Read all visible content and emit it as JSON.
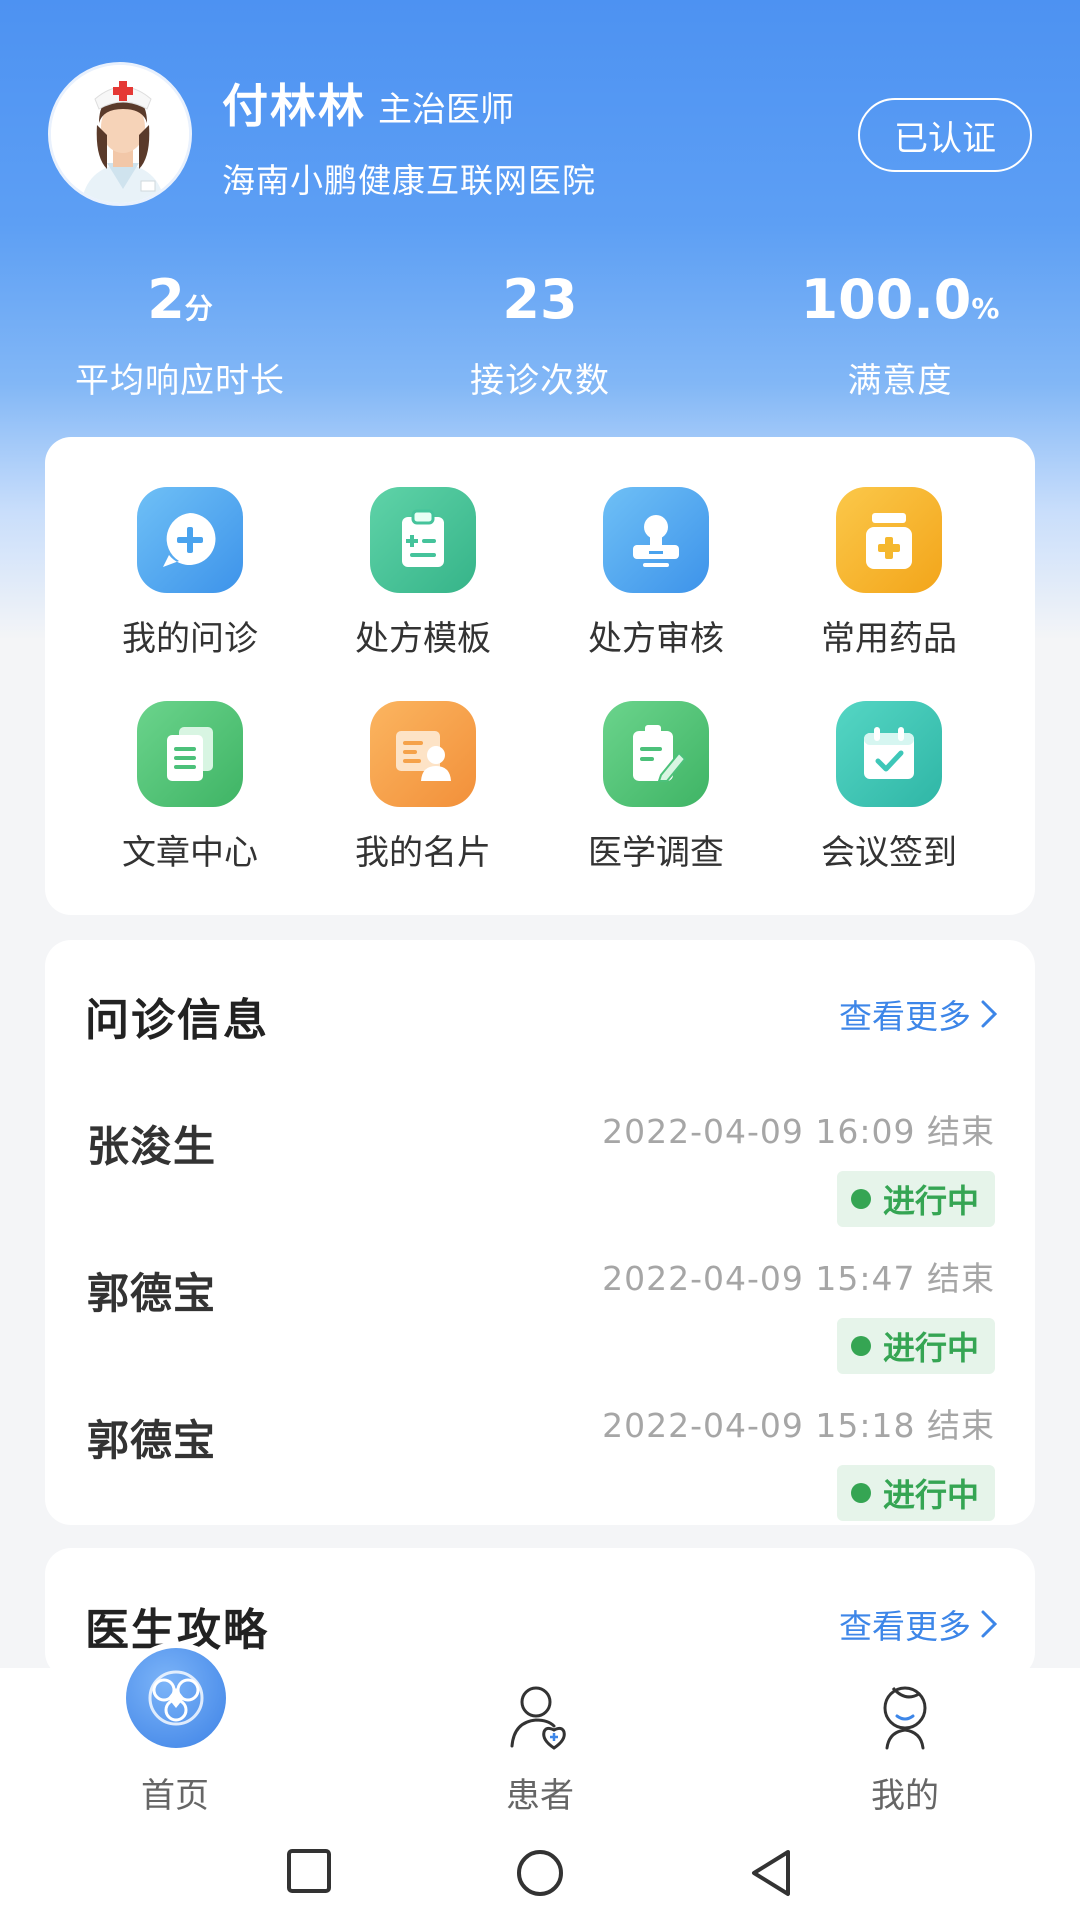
{
  "profile": {
    "name": "付林林",
    "title": "主治医师",
    "hospital": "海南小鹏健康互联网医院",
    "cert_label": "已认证"
  },
  "stats": [
    {
      "value": "2",
      "unit": "分",
      "label": "平均响应时长"
    },
    {
      "value": "23",
      "unit": "",
      "label": "接诊次数"
    },
    {
      "value": "100.0",
      "unit": "%",
      "label": "满意度"
    }
  ],
  "functions": [
    {
      "label": "我的问诊",
      "icon": "consult-bubble-icon",
      "color": "#4aa3ee"
    },
    {
      "label": "处方模板",
      "icon": "clipboard-icon",
      "color": "#45c39b"
    },
    {
      "label": "处方审核",
      "icon": "stamp-icon",
      "color": "#4aa3ee"
    },
    {
      "label": "常用药品",
      "icon": "medicine-bottle-icon",
      "color": "#f5b82e"
    },
    {
      "label": "文章中心",
      "icon": "documents-icon",
      "color": "#4cc17a"
    },
    {
      "label": "我的名片",
      "icon": "business-card-icon",
      "color": "#f5a24a"
    },
    {
      "label": "医学调查",
      "icon": "survey-icon",
      "color": "#4cc17a"
    },
    {
      "label": "会议签到",
      "icon": "calendar-check-icon",
      "color": "#3ec7b8"
    }
  ],
  "consult": {
    "title": "问诊信息",
    "more_label": "查看更多",
    "items": [
      {
        "name": "张浚生",
        "time": "2022-04-09 16:09 结束",
        "status": "进行中"
      },
      {
        "name": "郭德宝",
        "time": "2022-04-09 15:47 结束",
        "status": "进行中"
      },
      {
        "name": "郭德宝",
        "time": "2022-04-09 15:18 结束",
        "status": "进行中"
      }
    ]
  },
  "guide": {
    "title": "医生攻略",
    "more_label": "查看更多"
  },
  "tabbar": [
    {
      "label": "首页",
      "icon": "home-logo-icon"
    },
    {
      "label": "患者",
      "icon": "patient-icon"
    },
    {
      "label": "我的",
      "icon": "profile-icon"
    }
  ],
  "colors": {
    "brand_blue": "#4d92f2",
    "link_blue": "#3d86e8",
    "status_green": "#35a553",
    "status_bg": "#e6f4ea"
  }
}
